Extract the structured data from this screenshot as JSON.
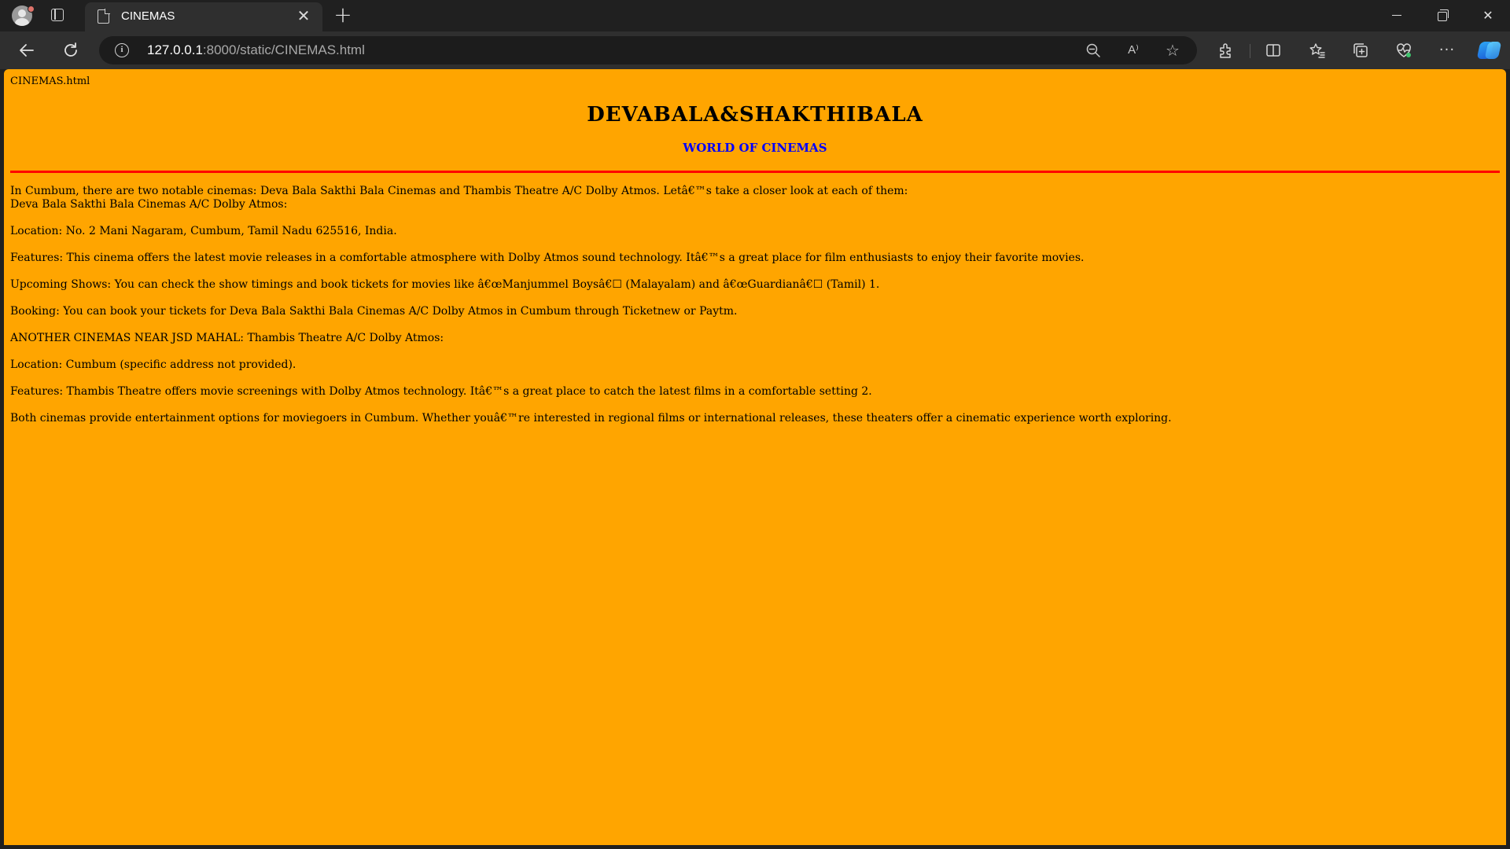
{
  "browser": {
    "tab_title": "CINEMAS",
    "tab_close": "✕",
    "new_tab": "+",
    "url_host": "127.0.0.1",
    "url_path": ":8000/static/CINEMAS.html",
    "read_aloud": "A⁾",
    "more": "···",
    "close_window": "✕"
  },
  "page": {
    "filename": "CINEMAS.html",
    "title": "DEVABALA&SHAKTHIBALA",
    "subtitle": "WORLD OF CINEMAS",
    "title_color": "#000000",
    "subtitle_color": "#0000ff",
    "rule_color": "#ff0000",
    "background": "#ffa500",
    "intro_line1": "In Cumbum, there are two notable cinemas: Deva Bala Sakthi Bala Cinemas and Thambis Theatre A/C Dolby Atmos. Letâ€™s take a closer look at each of them:",
    "intro_line2": "Deva Bala Sakthi Bala Cinemas A/C Dolby Atmos:",
    "paragraphs": [
      "Location: No. 2 Mani Nagaram, Cumbum, Tamil Nadu 625516, India.",
      "Features: This cinema offers the latest movie releases in a comfortable atmosphere with Dolby Atmos sound technology. Itâ€™s a great place for film enthusiasts to enjoy their favorite movies.",
      "Upcoming Shows: You can check the show timings and book tickets for movies like â€œManjummel Boysâ€☐ (Malayalam) and â€œGuardianâ€☐ (Tamil) 1.",
      "Booking: You can book your tickets for Deva Bala Sakthi Bala Cinemas A/C Dolby Atmos in Cumbum through Ticketnew or Paytm.",
      "ANOTHER CINEMAS NEAR JSD MAHAL: Thambis Theatre A/C Dolby Atmos:",
      "Location: Cumbum (specific address not provided).",
      "Features: Thambis Theatre offers movie screenings with Dolby Atmos technology. Itâ€™s a great place to catch the latest films in a comfortable setting 2.",
      "Both cinemas provide entertainment options for moviegoers in Cumbum. Whether youâ€™re interested in regional films or international releases, these theaters offer a cinematic experience worth exploring."
    ]
  }
}
